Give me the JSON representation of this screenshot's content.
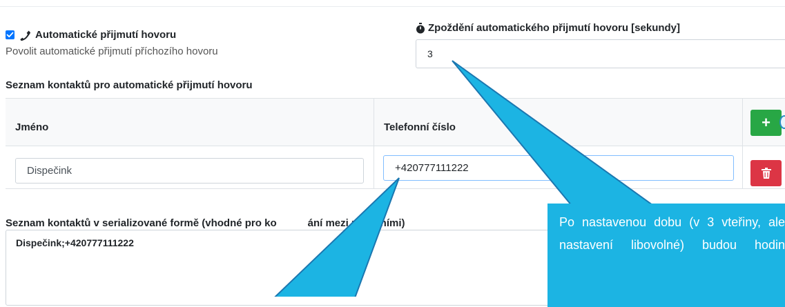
{
  "auto_answer": {
    "checked": true,
    "label": "Automatické přijmutí hovoru",
    "help": "Povolit automatické přijmutí příchozího hovoru"
  },
  "delay": {
    "label": "Zpoždění automatického přijmutí hovoru [sekundy]",
    "value": "3"
  },
  "contacts": {
    "section_label": "Seznam kontaktů pro automatické přijmutí hovoru",
    "columns": [
      "Jméno",
      "Telefonní číslo"
    ],
    "rows": [
      {
        "name": "Dispečink",
        "phone": "+420777111222"
      }
    ],
    "add_label": "+"
  },
  "serialized": {
    "label_part1": "Seznam kontaktů v serializované formě (vhodné pro ko",
    "label_part2": "ání mezi zařízeními)",
    "value": "Dispečink;+420777111222"
  },
  "callout": {
    "text": "Po nastavenou dobu (v 3 vteřiny, ale nastavení libovolné) budou hodin"
  },
  "colors": {
    "accent": "#1cb4e3",
    "add_button": "#28a745",
    "delete_button": "#dc3545",
    "checkbox": "#0075ff"
  }
}
